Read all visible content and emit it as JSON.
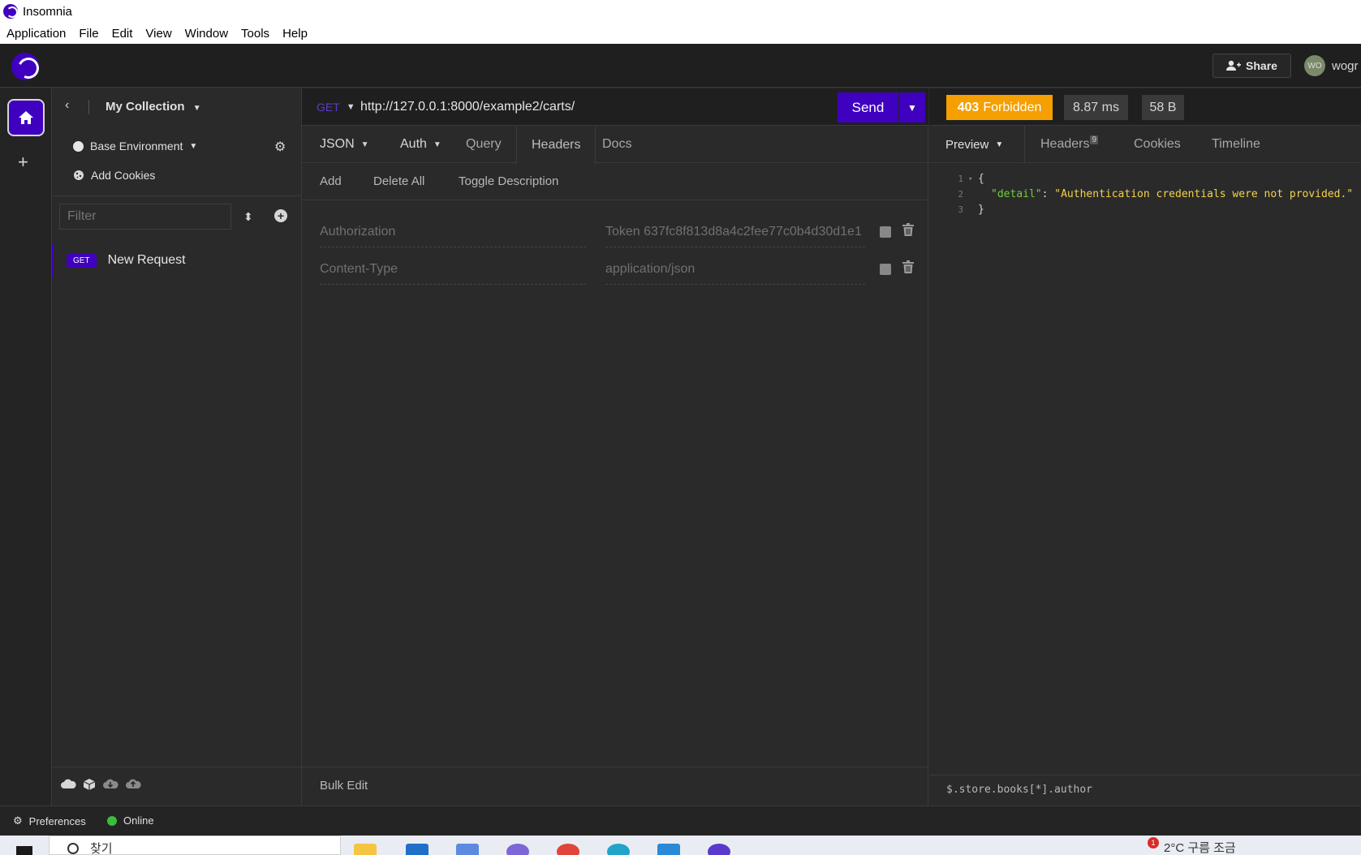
{
  "window": {
    "title": "Insomnia"
  },
  "menu": [
    "Application",
    "File",
    "Edit",
    "View",
    "Window",
    "Tools",
    "Help"
  ],
  "header": {
    "share_label": "Share",
    "avatar_initials": "WO",
    "username": "wogr"
  },
  "sidebar": {
    "collection": "My Collection",
    "environment": "Base Environment",
    "add_cookies": "Add Cookies",
    "filter_placeholder": "Filter",
    "requests": [
      {
        "method": "GET",
        "name": "New Request"
      }
    ]
  },
  "request": {
    "method": "GET",
    "url": "http://127.0.0.1:8000/example2/carts/",
    "send_label": "Send",
    "tabs": [
      "JSON",
      "Auth",
      "Query",
      "Headers",
      "Docs"
    ],
    "active_tab": "Headers",
    "actions": [
      "Add",
      "Delete All",
      "Toggle Description"
    ],
    "headers": [
      {
        "name": "Authorization",
        "value": "Token 637fc8f813d8a4c2fee77c0b4d30d1e1"
      },
      {
        "name": "Content-Type",
        "value": "application/json"
      }
    ],
    "bulk_edit": "Bulk Edit"
  },
  "response": {
    "status_code": "403",
    "status_text": "Forbidden",
    "time": "8.87 ms",
    "size": "58 B",
    "tabs": [
      "Preview",
      "Headers",
      "Cookies",
      "Timeline"
    ],
    "headers_count": "9",
    "body_lines": [
      {
        "n": "1",
        "text": "{"
      },
      {
        "n": "2",
        "key": "\"detail\"",
        "value": "\"Authentication credentials were not provided.\""
      },
      {
        "n": "3",
        "text": "}"
      }
    ],
    "filter_query": "$.store.books[*].author"
  },
  "statusbar": {
    "preferences": "Preferences",
    "online": "Online"
  },
  "taskbar": {
    "search_text": "찾기",
    "notification_count": "1",
    "tray_text": "2°C 구름 조금"
  },
  "colors": {
    "accent": "#4000bf",
    "warning": "#f59f00",
    "json_key": "#6fcf37",
    "json_string": "#f5d24a"
  }
}
